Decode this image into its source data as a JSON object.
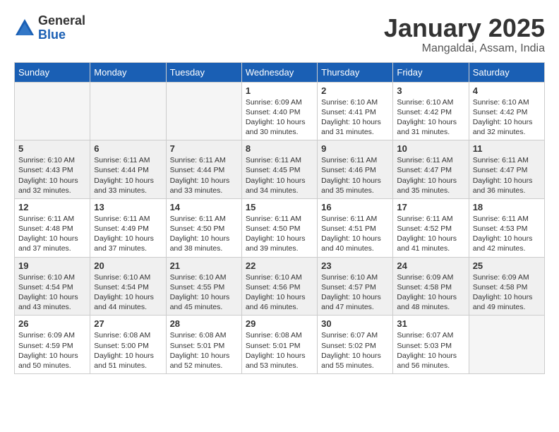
{
  "header": {
    "logo_general": "General",
    "logo_blue": "Blue",
    "month_title": "January 2025",
    "location": "Mangaldai, Assam, India"
  },
  "days_of_week": [
    "Sunday",
    "Monday",
    "Tuesday",
    "Wednesday",
    "Thursday",
    "Friday",
    "Saturday"
  ],
  "weeks": [
    {
      "shaded": false,
      "days": [
        {
          "num": "",
          "info": ""
        },
        {
          "num": "",
          "info": ""
        },
        {
          "num": "",
          "info": ""
        },
        {
          "num": "1",
          "info": "Sunrise: 6:09 AM\nSunset: 4:40 PM\nDaylight: 10 hours\nand 30 minutes."
        },
        {
          "num": "2",
          "info": "Sunrise: 6:10 AM\nSunset: 4:41 PM\nDaylight: 10 hours\nand 31 minutes."
        },
        {
          "num": "3",
          "info": "Sunrise: 6:10 AM\nSunset: 4:42 PM\nDaylight: 10 hours\nand 31 minutes."
        },
        {
          "num": "4",
          "info": "Sunrise: 6:10 AM\nSunset: 4:42 PM\nDaylight: 10 hours\nand 32 minutes."
        }
      ]
    },
    {
      "shaded": true,
      "days": [
        {
          "num": "5",
          "info": "Sunrise: 6:10 AM\nSunset: 4:43 PM\nDaylight: 10 hours\nand 32 minutes."
        },
        {
          "num": "6",
          "info": "Sunrise: 6:11 AM\nSunset: 4:44 PM\nDaylight: 10 hours\nand 33 minutes."
        },
        {
          "num": "7",
          "info": "Sunrise: 6:11 AM\nSunset: 4:44 PM\nDaylight: 10 hours\nand 33 minutes."
        },
        {
          "num": "8",
          "info": "Sunrise: 6:11 AM\nSunset: 4:45 PM\nDaylight: 10 hours\nand 34 minutes."
        },
        {
          "num": "9",
          "info": "Sunrise: 6:11 AM\nSunset: 4:46 PM\nDaylight: 10 hours\nand 35 minutes."
        },
        {
          "num": "10",
          "info": "Sunrise: 6:11 AM\nSunset: 4:47 PM\nDaylight: 10 hours\nand 35 minutes."
        },
        {
          "num": "11",
          "info": "Sunrise: 6:11 AM\nSunset: 4:47 PM\nDaylight: 10 hours\nand 36 minutes."
        }
      ]
    },
    {
      "shaded": false,
      "days": [
        {
          "num": "12",
          "info": "Sunrise: 6:11 AM\nSunset: 4:48 PM\nDaylight: 10 hours\nand 37 minutes."
        },
        {
          "num": "13",
          "info": "Sunrise: 6:11 AM\nSunset: 4:49 PM\nDaylight: 10 hours\nand 37 minutes."
        },
        {
          "num": "14",
          "info": "Sunrise: 6:11 AM\nSunset: 4:50 PM\nDaylight: 10 hours\nand 38 minutes."
        },
        {
          "num": "15",
          "info": "Sunrise: 6:11 AM\nSunset: 4:50 PM\nDaylight: 10 hours\nand 39 minutes."
        },
        {
          "num": "16",
          "info": "Sunrise: 6:11 AM\nSunset: 4:51 PM\nDaylight: 10 hours\nand 40 minutes."
        },
        {
          "num": "17",
          "info": "Sunrise: 6:11 AM\nSunset: 4:52 PM\nDaylight: 10 hours\nand 41 minutes."
        },
        {
          "num": "18",
          "info": "Sunrise: 6:11 AM\nSunset: 4:53 PM\nDaylight: 10 hours\nand 42 minutes."
        }
      ]
    },
    {
      "shaded": true,
      "days": [
        {
          "num": "19",
          "info": "Sunrise: 6:10 AM\nSunset: 4:54 PM\nDaylight: 10 hours\nand 43 minutes."
        },
        {
          "num": "20",
          "info": "Sunrise: 6:10 AM\nSunset: 4:54 PM\nDaylight: 10 hours\nand 44 minutes."
        },
        {
          "num": "21",
          "info": "Sunrise: 6:10 AM\nSunset: 4:55 PM\nDaylight: 10 hours\nand 45 minutes."
        },
        {
          "num": "22",
          "info": "Sunrise: 6:10 AM\nSunset: 4:56 PM\nDaylight: 10 hours\nand 46 minutes."
        },
        {
          "num": "23",
          "info": "Sunrise: 6:10 AM\nSunset: 4:57 PM\nDaylight: 10 hours\nand 47 minutes."
        },
        {
          "num": "24",
          "info": "Sunrise: 6:09 AM\nSunset: 4:58 PM\nDaylight: 10 hours\nand 48 minutes."
        },
        {
          "num": "25",
          "info": "Sunrise: 6:09 AM\nSunset: 4:58 PM\nDaylight: 10 hours\nand 49 minutes."
        }
      ]
    },
    {
      "shaded": false,
      "days": [
        {
          "num": "26",
          "info": "Sunrise: 6:09 AM\nSunset: 4:59 PM\nDaylight: 10 hours\nand 50 minutes."
        },
        {
          "num": "27",
          "info": "Sunrise: 6:08 AM\nSunset: 5:00 PM\nDaylight: 10 hours\nand 51 minutes."
        },
        {
          "num": "28",
          "info": "Sunrise: 6:08 AM\nSunset: 5:01 PM\nDaylight: 10 hours\nand 52 minutes."
        },
        {
          "num": "29",
          "info": "Sunrise: 6:08 AM\nSunset: 5:01 PM\nDaylight: 10 hours\nand 53 minutes."
        },
        {
          "num": "30",
          "info": "Sunrise: 6:07 AM\nSunset: 5:02 PM\nDaylight: 10 hours\nand 55 minutes."
        },
        {
          "num": "31",
          "info": "Sunrise: 6:07 AM\nSunset: 5:03 PM\nDaylight: 10 hours\nand 56 minutes."
        },
        {
          "num": "",
          "info": ""
        }
      ]
    }
  ]
}
